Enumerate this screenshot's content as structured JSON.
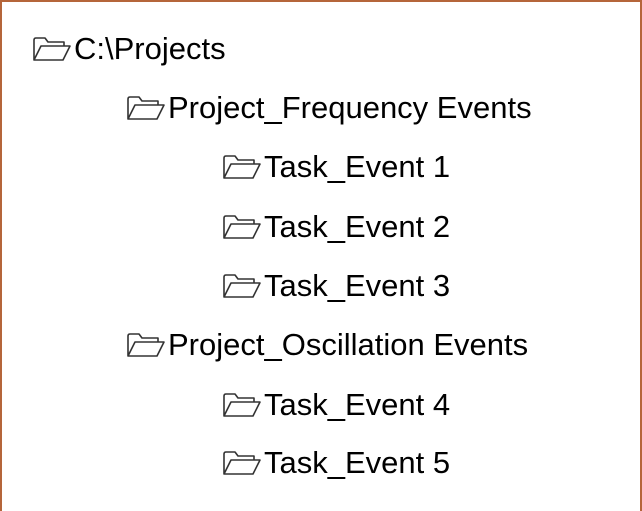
{
  "frame": {
    "border_color": "#b5653a"
  },
  "tree": {
    "root": {
      "label": "C:\\Projects",
      "icon": "folder-icon"
    },
    "projects": [
      {
        "label": "Project_Frequency Events",
        "icon": "folder-icon",
        "tasks": [
          {
            "label": "Task_Event 1",
            "icon": "folder-icon"
          },
          {
            "label": "Task_Event 2",
            "icon": "folder-icon"
          },
          {
            "label": "Task_Event 3",
            "icon": "folder-icon"
          }
        ]
      },
      {
        "label": "Project_Oscillation Events",
        "icon": "folder-icon",
        "tasks": [
          {
            "label": "Task_Event 4",
            "icon": "folder-icon"
          },
          {
            "label": "Task_Event 5",
            "icon": "folder-icon"
          }
        ]
      }
    ]
  }
}
